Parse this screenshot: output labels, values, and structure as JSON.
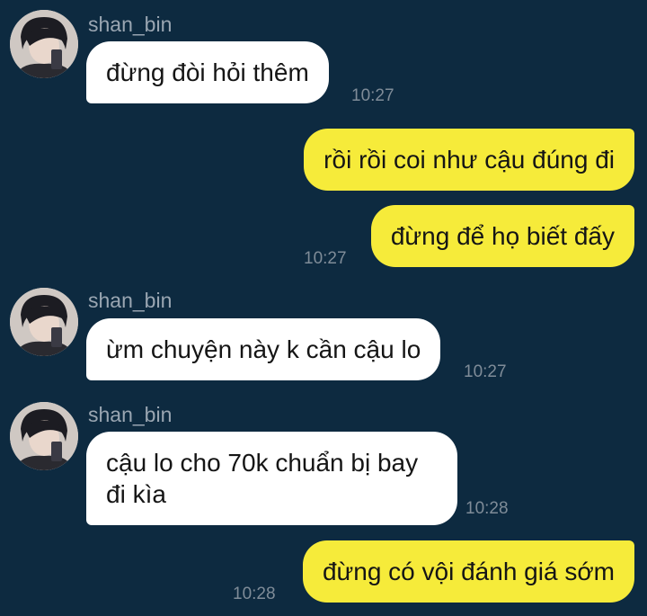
{
  "messages": [
    {
      "sender": "shan_bin",
      "text": "đừng đòi hỏi thêm",
      "time": "10:27"
    },
    {
      "sender": "me",
      "text": "rồi rồi coi như cậu đúng đi",
      "time": ""
    },
    {
      "sender": "me",
      "text": "đừng để họ biết đấy",
      "time": "10:27"
    },
    {
      "sender": "shan_bin",
      "text": "ừm chuyện này k cần cậu lo",
      "time": "10:27"
    },
    {
      "sender": "shan_bin",
      "text": "cậu lo cho 70k chuẩn bị bay đi kìa",
      "time": "10:28"
    },
    {
      "sender": "me",
      "text": "đừng có vội đánh giá sớm",
      "time": "10:28"
    }
  ],
  "colors": {
    "background": "#0d2a40",
    "incoming_bubble": "#ffffff",
    "outgoing_bubble": "#f6eb3a"
  },
  "icons": {
    "avatar": "avatar-photo"
  }
}
